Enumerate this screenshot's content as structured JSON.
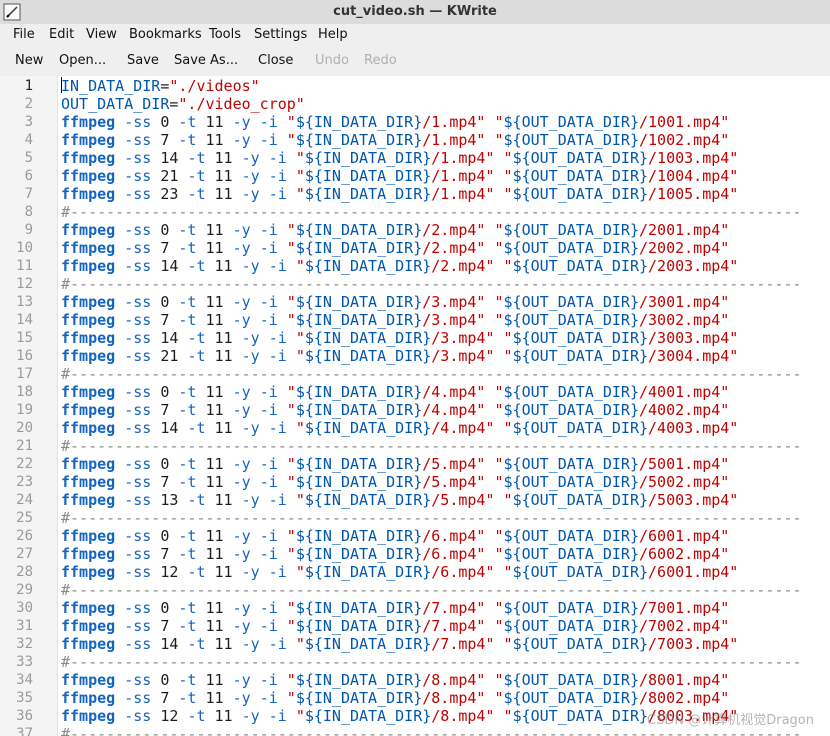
{
  "window": {
    "title": "cut_video.sh  — KWrite"
  },
  "menu": [
    "File",
    "Edit",
    "View",
    "Bookmarks",
    "Tools",
    "Settings",
    "Help"
  ],
  "toolbar": [
    {
      "label": "New",
      "enabled": true
    },
    {
      "label": "Open...",
      "enabled": true
    },
    {
      "label": "Save",
      "enabled": true
    },
    {
      "label": "Save As...",
      "enabled": true
    },
    {
      "label": "Close",
      "enabled": true
    },
    {
      "label": "Undo",
      "enabled": false
    },
    {
      "label": "Redo",
      "enabled": false
    }
  ],
  "editor": {
    "current_line": 1,
    "lines": [
      "IN_DATA_DIR=\"./videos\"",
      "OUT_DATA_DIR=\"./video_crop\"",
      "ffmpeg -ss 0 -t 11 -y -i \"${IN_DATA_DIR}/1.mp4\" \"${OUT_DATA_DIR}/1001.mp4\"",
      "ffmpeg -ss 7 -t 11 -y -i \"${IN_DATA_DIR}/1.mp4\" \"${OUT_DATA_DIR}/1002.mp4\"",
      "ffmpeg -ss 14 -t 11 -y -i \"${IN_DATA_DIR}/1.mp4\" \"${OUT_DATA_DIR}/1003.mp4\"",
      "ffmpeg -ss 21 -t 11 -y -i \"${IN_DATA_DIR}/1.mp4\" \"${OUT_DATA_DIR}/1004.mp4\"",
      "ffmpeg -ss 23 -t 11 -y -i \"${IN_DATA_DIR}/1.mp4\" \"${OUT_DATA_DIR}/1005.mp4\"",
      "#---------------------------------------------------------------------------------",
      "ffmpeg -ss 0 -t 11 -y -i \"${IN_DATA_DIR}/2.mp4\" \"${OUT_DATA_DIR}/2001.mp4\"",
      "ffmpeg -ss 7 -t 11 -y -i \"${IN_DATA_DIR}/2.mp4\" \"${OUT_DATA_DIR}/2002.mp4\"",
      "ffmpeg -ss 14 -t 11 -y -i \"${IN_DATA_DIR}/2.mp4\" \"${OUT_DATA_DIR}/2003.mp4\"",
      "#---------------------------------------------------------------------------------",
      "ffmpeg -ss 0 -t 11 -y -i \"${IN_DATA_DIR}/3.mp4\" \"${OUT_DATA_DIR}/3001.mp4\"",
      "ffmpeg -ss 7 -t 11 -y -i \"${IN_DATA_DIR}/3.mp4\" \"${OUT_DATA_DIR}/3002.mp4\"",
      "ffmpeg -ss 14 -t 11 -y -i \"${IN_DATA_DIR}/3.mp4\" \"${OUT_DATA_DIR}/3003.mp4\"",
      "ffmpeg -ss 21 -t 11 -y -i \"${IN_DATA_DIR}/3.mp4\" \"${OUT_DATA_DIR}/3004.mp4\"",
      "#---------------------------------------------------------------------------------",
      "ffmpeg -ss 0 -t 11 -y -i \"${IN_DATA_DIR}/4.mp4\" \"${OUT_DATA_DIR}/4001.mp4\"",
      "ffmpeg -ss 7 -t 11 -y -i \"${IN_DATA_DIR}/4.mp4\" \"${OUT_DATA_DIR}/4002.mp4\"",
      "ffmpeg -ss 14 -t 11 -y -i \"${IN_DATA_DIR}/4.mp4\" \"${OUT_DATA_DIR}/4003.mp4\"",
      "#---------------------------------------------------------------------------------",
      "ffmpeg -ss 0 -t 11 -y -i \"${IN_DATA_DIR}/5.mp4\" \"${OUT_DATA_DIR}/5001.mp4\"",
      "ffmpeg -ss 7 -t 11 -y -i \"${IN_DATA_DIR}/5.mp4\" \"${OUT_DATA_DIR}/5002.mp4\"",
      "ffmpeg -ss 13 -t 11 -y -i \"${IN_DATA_DIR}/5.mp4\" \"${OUT_DATA_DIR}/5003.mp4\"",
      "#---------------------------------------------------------------------------------",
      "ffmpeg -ss 0 -t 11 -y -i \"${IN_DATA_DIR}/6.mp4\" \"${OUT_DATA_DIR}/6001.mp4\"",
      "ffmpeg -ss 7 -t 11 -y -i \"${IN_DATA_DIR}/6.mp4\" \"${OUT_DATA_DIR}/6002.mp4\"",
      "ffmpeg -ss 12 -t 11 -y -i \"${IN_DATA_DIR}/6.mp4\" \"${OUT_DATA_DIR}/6001.mp4\"",
      "#---------------------------------------------------------------------------------",
      "ffmpeg -ss 0 -t 11 -y -i \"${IN_DATA_DIR}/7.mp4\" \"${OUT_DATA_DIR}/7001.mp4\"",
      "ffmpeg -ss 7 -t 11 -y -i \"${IN_DATA_DIR}/7.mp4\" \"${OUT_DATA_DIR}/7002.mp4\"",
      "ffmpeg -ss 14 -t 11 -y -i \"${IN_DATA_DIR}/7.mp4\" \"${OUT_DATA_DIR}/7003.mp4\"",
      "#---------------------------------------------------------------------------------",
      "ffmpeg -ss 0 -t 11 -y -i \"${IN_DATA_DIR}/8.mp4\" \"${OUT_DATA_DIR}/8001.mp4\"",
      "ffmpeg -ss 7 -t 11 -y -i \"${IN_DATA_DIR}/8.mp4\" \"${OUT_DATA_DIR}/8002.mp4\"",
      "ffmpeg -ss 12 -t 11 -y -i \"${IN_DATA_DIR}/8.mp4\" \"${OUT_DATA_DIR}/8003.mp4\"",
      "#---------------------------------------------------------------------------------"
    ]
  },
  "watermark": "CSDN @计算机视觉Dragon",
  "colors": {
    "command": "#1565c0",
    "string": "#bf0303",
    "variable": "#0057ae",
    "comment": "#8a8a8a",
    "line_number": "#9a9a9a"
  }
}
